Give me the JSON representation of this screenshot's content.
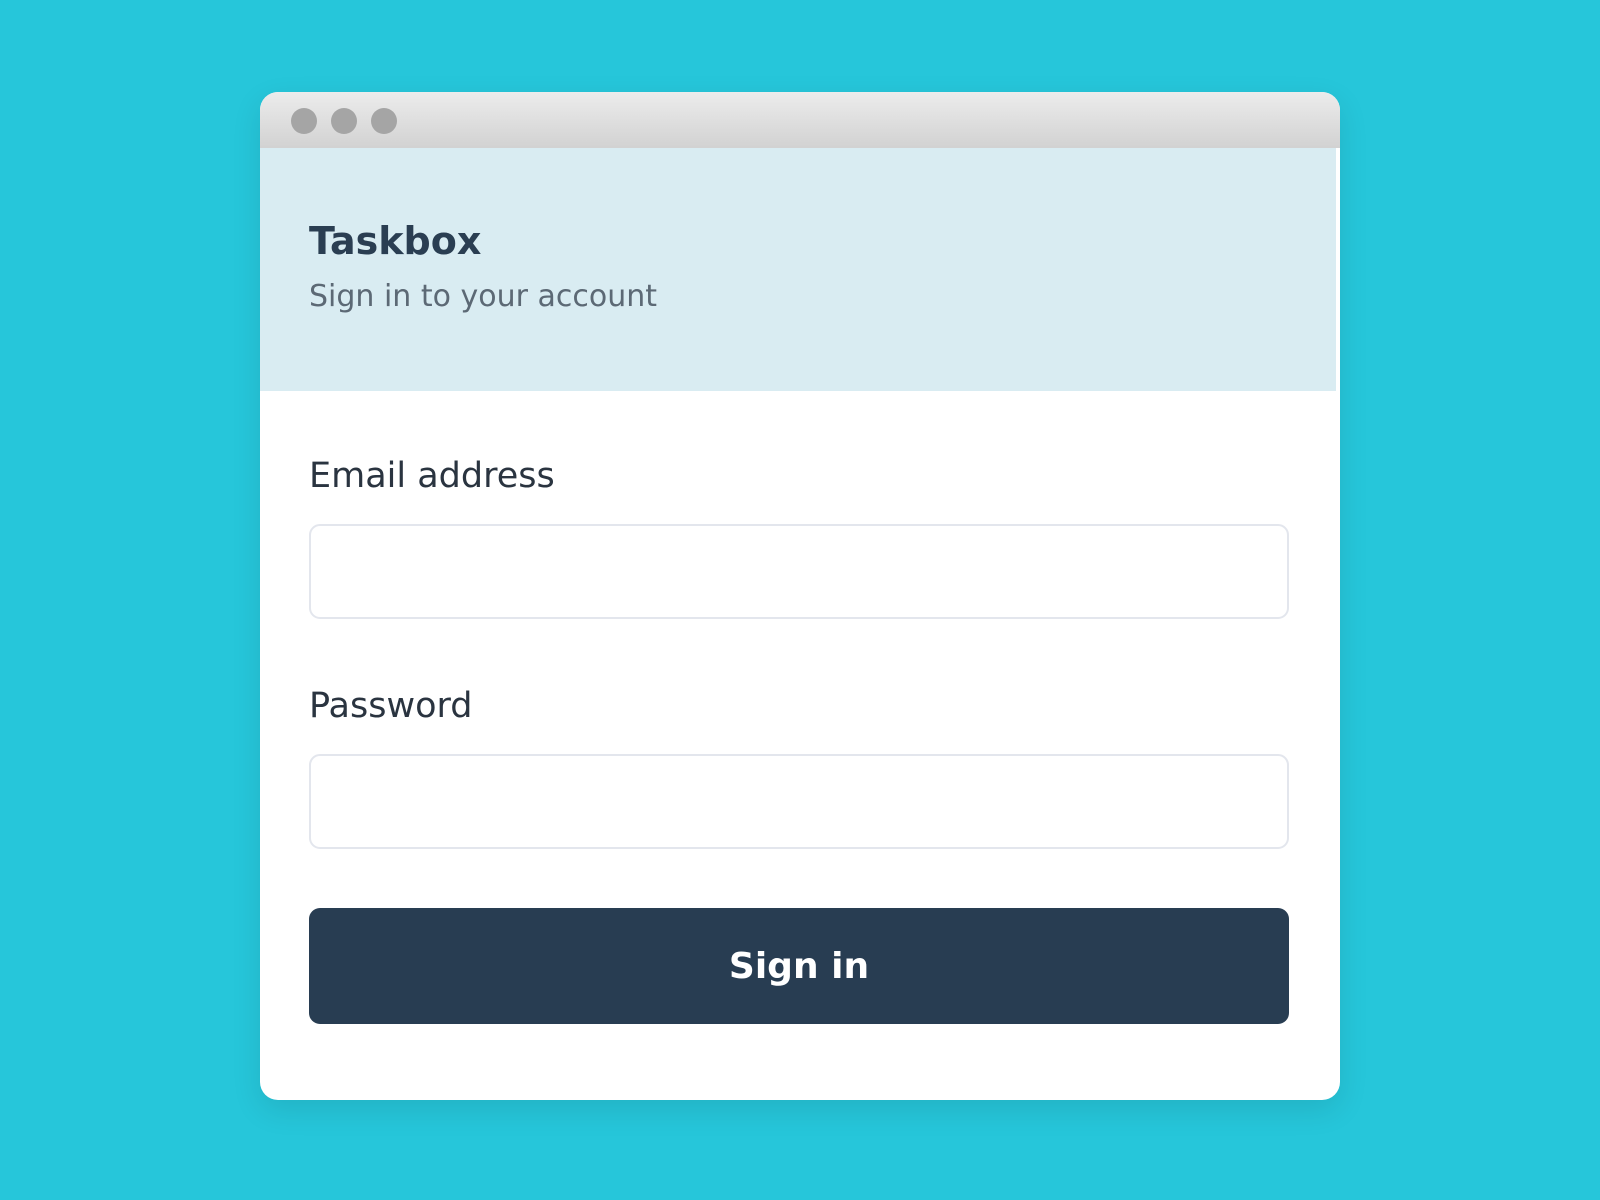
{
  "app": {
    "title": "Taskbox",
    "subtitle": "Sign in to your account"
  },
  "form": {
    "email_label": "Email address",
    "email_value": "",
    "password_label": "Password",
    "password_value": "",
    "submit_label": "Sign in"
  },
  "colors": {
    "background": "#26c6da",
    "header_background": "#d9ecf2",
    "button_background": "#283d52",
    "title_text": "#2a3e52"
  }
}
